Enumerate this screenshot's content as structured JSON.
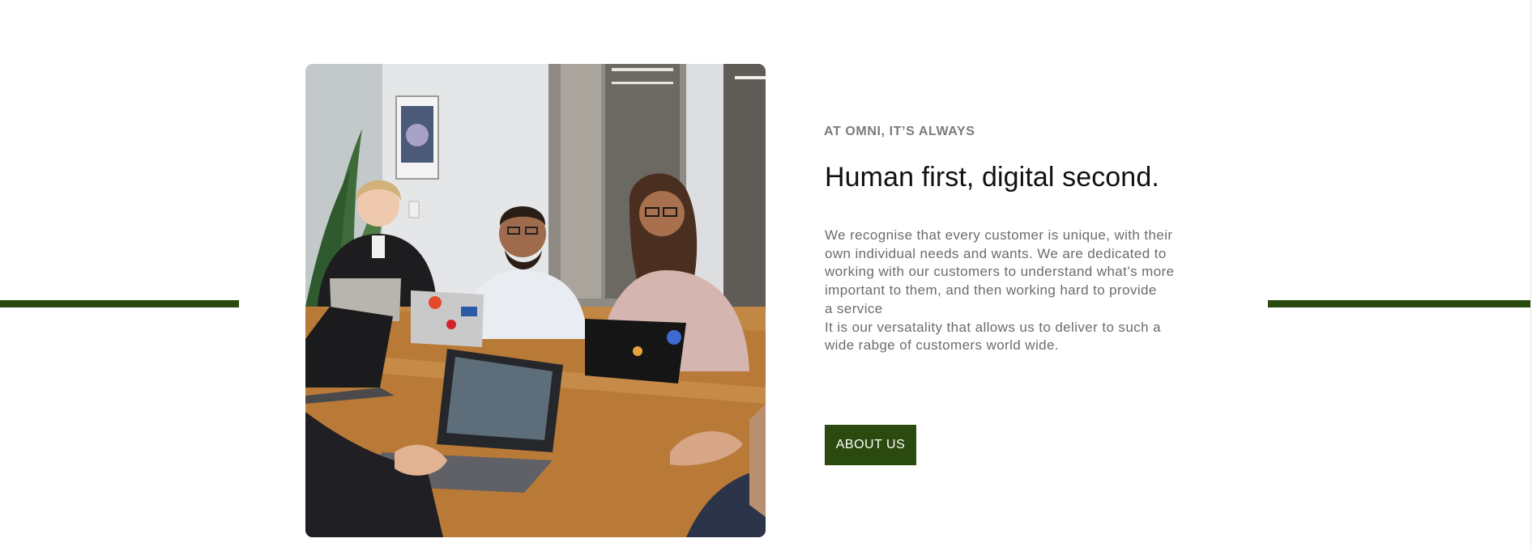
{
  "section": {
    "eyebrow": "AT OMNI, IT’S ALWAYS",
    "heading": "Human first, digital second.",
    "paragraph_1": "We recognise that every customer is unique, with their\nown individual needs and wants. We are dedicated to\nworking with our customers to understand what’s more\nimportant to them, and then working hard to provide\na service",
    "paragraph_2": "It is our versatality that allows us to deliver to such a\nwide rabge of customers world wide.",
    "button_label": "ABOUT US"
  },
  "colors": {
    "accent": "#2b4a0f",
    "eyebrow": "#7b7b7b",
    "heading": "#111111",
    "body": "#6c6c6c",
    "background": "#ffffff"
  },
  "image": {
    "subject": "team-meeting-photo"
  }
}
